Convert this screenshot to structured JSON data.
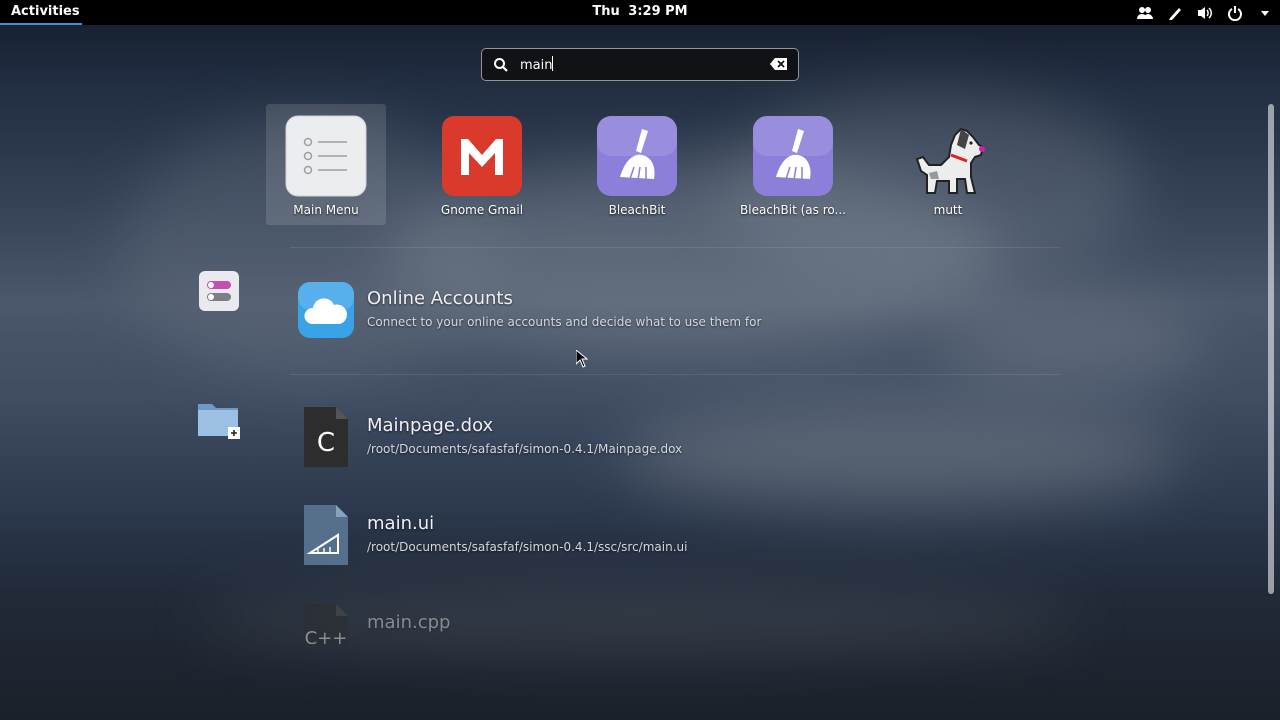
{
  "topbar": {
    "activities_label": "Activities",
    "clock_day": "Thu",
    "clock_time": "3:29 PM",
    "tray_icons": [
      "people-icon",
      "edit-pen-icon",
      "volume-icon",
      "power-icon",
      "dropdown-arrow-icon"
    ]
  },
  "search": {
    "query": "main",
    "icon": "search-icon",
    "clear_icon": "clear-icon"
  },
  "apps": [
    {
      "label": "Main Menu",
      "icon": "main-menu-icon",
      "selected": true
    },
    {
      "label": "Gnome Gmail",
      "icon": "gmail-icon",
      "selected": false
    },
    {
      "label": "BleachBit",
      "icon": "bleachbit-icon",
      "selected": false
    },
    {
      "label": "BleachBit (as ro...",
      "icon": "bleachbit-icon",
      "selected": false
    },
    {
      "label": "mutt",
      "icon": "mutt-dog-icon",
      "selected": false
    }
  ],
  "providers": [
    {
      "name": "settings-provider-icon"
    },
    {
      "name": "files-provider-icon"
    }
  ],
  "results": [
    {
      "title": "Online Accounts",
      "subtitle": "Connect to your online accounts and decide what to use them for",
      "icon": "cloud-icon"
    },
    {
      "title": "Mainpage.dox",
      "subtitle": "/root/Documents/safasfaf/simon-0.4.1/Mainpage.dox",
      "icon": "c-source-file-icon",
      "glyph": "C"
    },
    {
      "title": "main.ui",
      "subtitle": "/root/Documents/safasfaf/simon-0.4.1/ssc/src/main.ui",
      "icon": "ui-file-icon"
    },
    {
      "title": "main.cpp",
      "subtitle": "",
      "icon": "cpp-file-icon",
      "glyph": "C++"
    }
  ],
  "colors": {
    "topbar": "#000000",
    "accent": "#3d8ee0",
    "gmail_red": "#d93a2b",
    "bleachbit_purple": "#8b7fd9",
    "online_accounts_blue": "#3aa3e8"
  }
}
